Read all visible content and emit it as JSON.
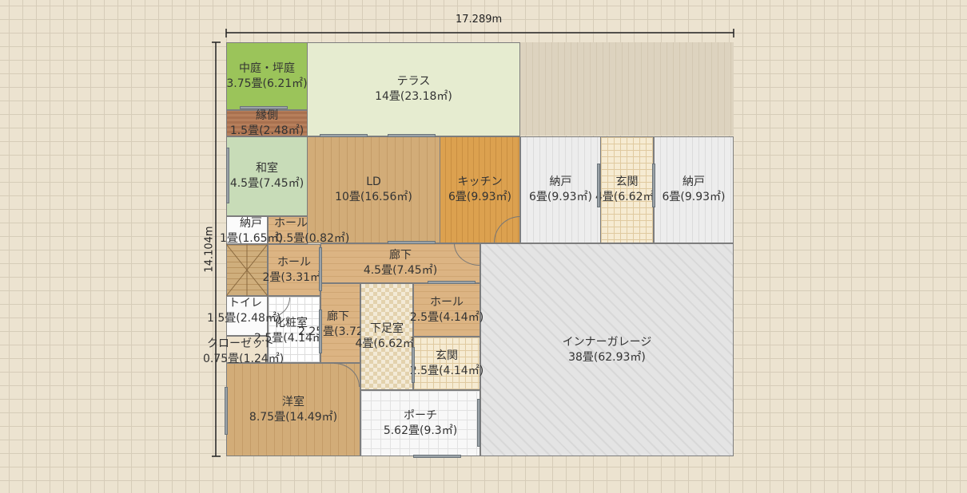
{
  "dimensions": {
    "width_label": "17.289m",
    "height_label": "14.104m"
  },
  "rooms": {
    "nakaniwa": {
      "name": "中庭・坪庭",
      "area": "3.75畳(6.21㎡)"
    },
    "engawa": {
      "name": "縁側",
      "area": "1.5畳(2.48㎡)"
    },
    "terrace": {
      "name": "テラス",
      "area": "14畳(23.18㎡)"
    },
    "washitsu": {
      "name": "和室",
      "area": "4.5畳(7.45㎡)"
    },
    "ld": {
      "name": "LD",
      "area": "10畳(16.56㎡)"
    },
    "kitchen": {
      "name": "キッチン",
      "area": "6畳(9.93㎡)"
    },
    "nando1": {
      "name": "納戸",
      "area": "6畳(9.93㎡)"
    },
    "genkan_upper": {
      "name": "玄関",
      "area": "4畳(6.62㎡)"
    },
    "nando2": {
      "name": "納戸",
      "area": "6畳(9.93㎡)"
    },
    "nando_small": {
      "name": "納戸",
      "area": "1畳(1.65㎡)"
    },
    "hall_small": {
      "name": "ホール",
      "area": "0.5畳(0.82㎡)"
    },
    "hall_2": {
      "name": "ホール",
      "area": "2畳(3.31㎡)"
    },
    "rouka_upper": {
      "name": "廊下",
      "area": "4.5畳(7.45㎡)"
    },
    "toilet": {
      "name": "トイレ",
      "area": "1.5畳(2.48㎡)"
    },
    "keshoshitsu": {
      "name": "化粧室",
      "area": "2.5畳(4.14㎡)"
    },
    "rouka_mid": {
      "name": "廊下",
      "area": "2.25畳(3.72㎡)"
    },
    "gesokushitsu": {
      "name": "下足室",
      "area": "4畳(6.62㎡)"
    },
    "hall_25": {
      "name": "ホール",
      "area": "2.5畳(4.14㎡)"
    },
    "genkan_lower": {
      "name": "玄関",
      "area": "2.5畳(4.14㎡)"
    },
    "closet": {
      "name": "クローゼット",
      "area": "0.75畳(1.24㎡)"
    },
    "youshitsu": {
      "name": "洋室",
      "area": "8.75畳(14.49㎡)"
    },
    "porch": {
      "name": "ポーチ",
      "area": "5.62畳(9.3㎡)"
    },
    "garage": {
      "name": "インナーガレージ",
      "area": "38畳(62.93㎡)"
    }
  }
}
